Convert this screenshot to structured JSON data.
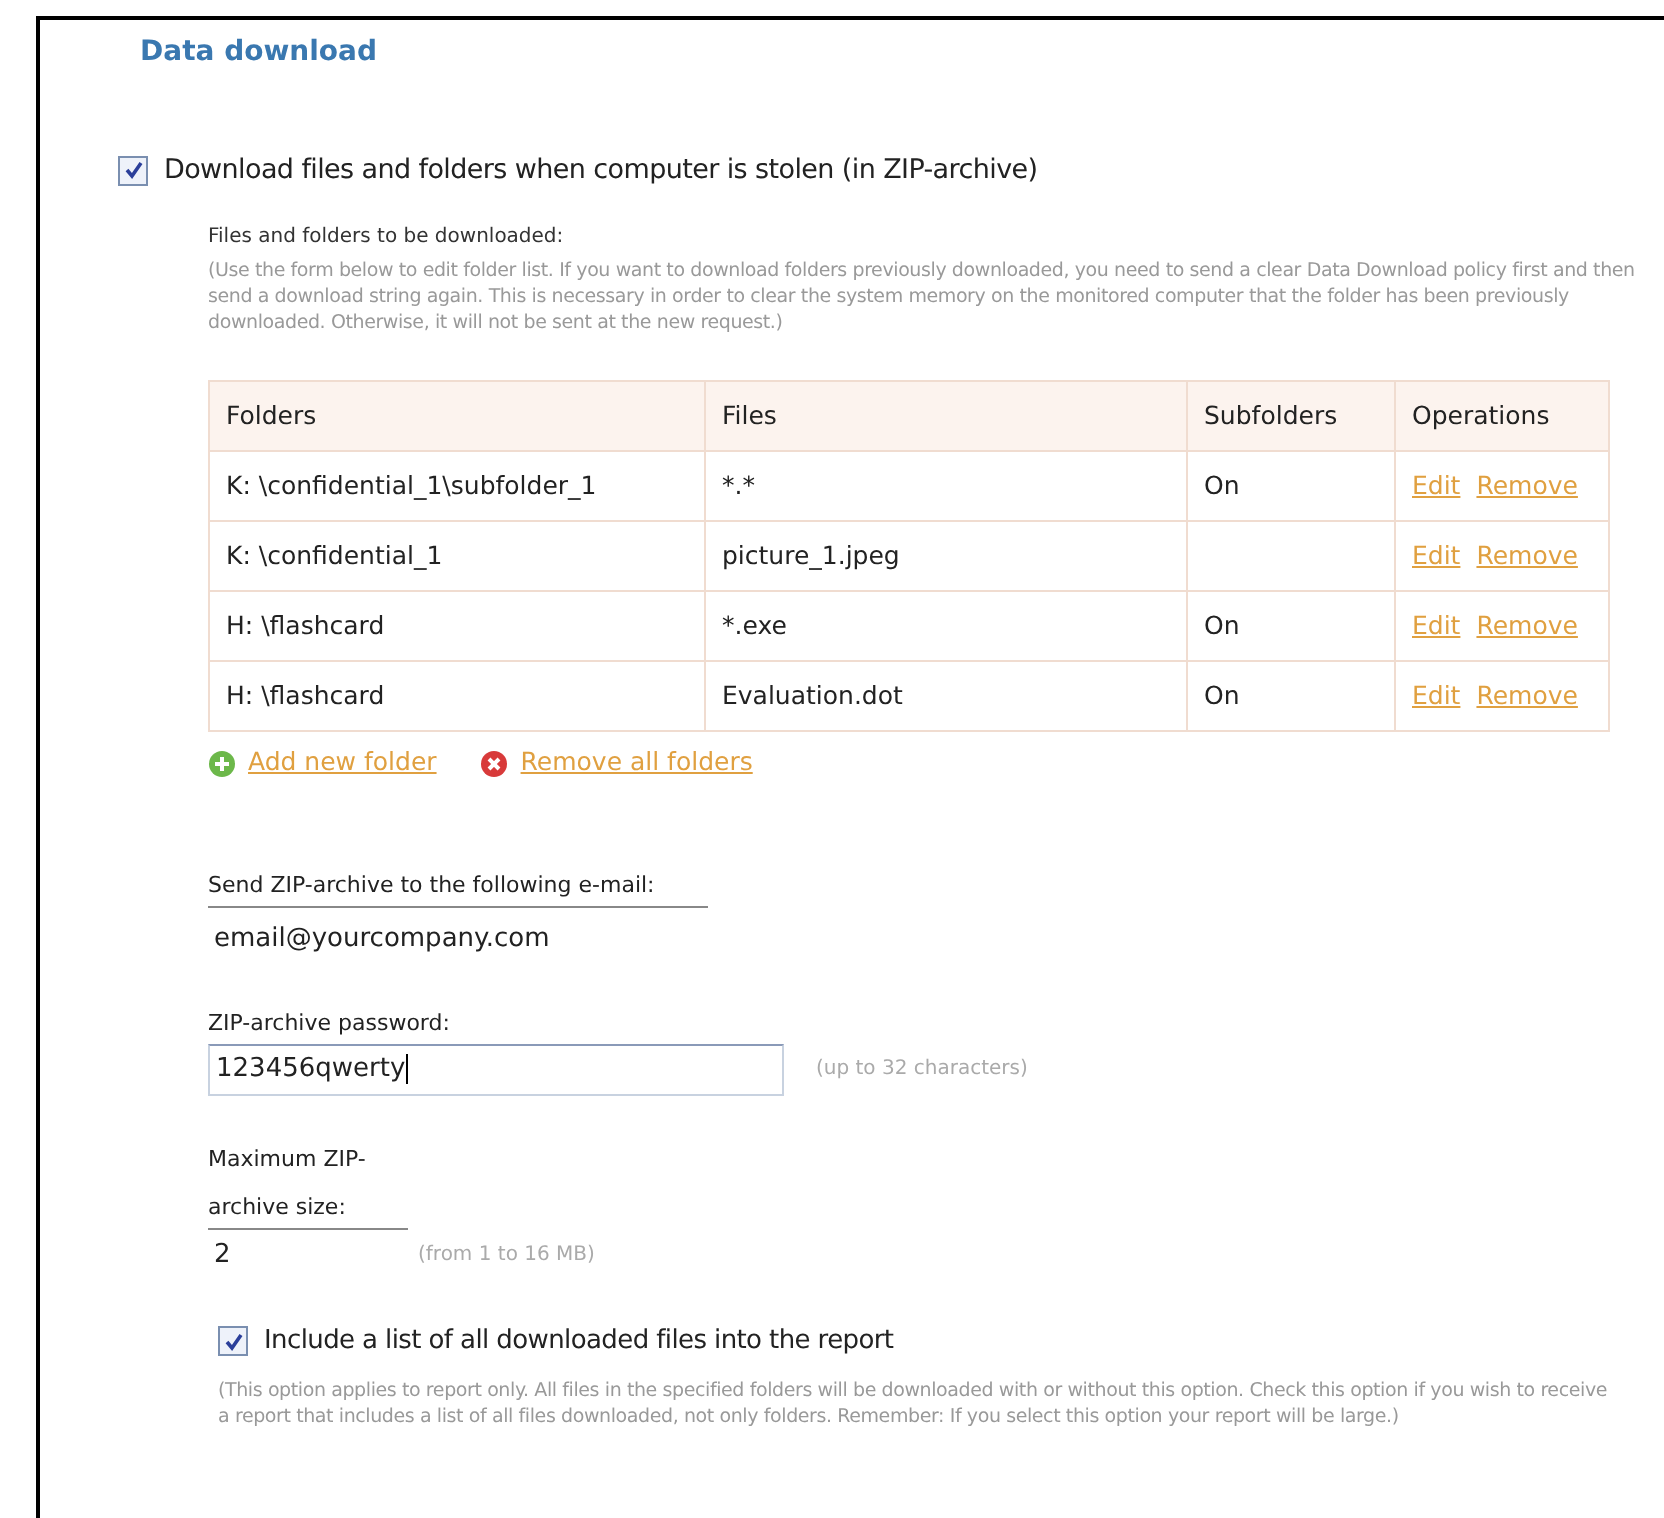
{
  "section_title": "Data download",
  "download_option": {
    "label": "Download files and folders when computer is stolen (in ZIP-archive)",
    "checked": true
  },
  "folders_heading": "Files and folders to be downloaded:",
  "folders_note": "(Use the form below to edit folder list. If you want to download folders previously downloaded, you need to send a clear Data Download policy first and then send a download string again. This is necessary in order to clear the system memory on the monitored computer that the folder has been previously downloaded. Otherwise, it will not be sent at the new request.)",
  "table": {
    "columns": [
      "Folders",
      "Files",
      "Subfolders",
      "Operations"
    ],
    "rows": [
      {
        "folder": "K: \\confidential_1\\subfolder_1",
        "files": "*.*",
        "subfolders": "On",
        "edit": "Edit",
        "remove": "Remove"
      },
      {
        "folder": "K: \\confidential_1",
        "files": "picture_1.jpeg",
        "subfolders": "",
        "edit": "Edit",
        "remove": "Remove"
      },
      {
        "folder": "H: \\flashcard",
        "files": "*.exe",
        "subfolders": "On",
        "edit": "Edit",
        "remove": "Remove"
      },
      {
        "folder": "H: \\flashcard",
        "files": "Evaluation.dot",
        "subfolders": "On",
        "edit": "Edit",
        "remove": "Remove"
      }
    ]
  },
  "actions": [
    {
      "kind": "add",
      "label": "Add new folder"
    },
    {
      "kind": "remove",
      "label": "Remove all folders"
    }
  ],
  "email": {
    "label": "Send ZIP-archive to the following e-mail:",
    "value": "email@yourcompany.com"
  },
  "password": {
    "label": "ZIP-archive password:",
    "value": "123456qwerty",
    "hint": "(up to 32 characters)"
  },
  "max_size": {
    "label": "Maximum ZIP-archive size:",
    "value": "2",
    "hint": "(from 1 to 16 MB)"
  },
  "report_option": {
    "label": "Include a list of all downloaded files into the report",
    "checked": true,
    "note": "(This option applies to report only. All files in the specified folders will be downloaded with or without this option. Check this option if you wish to receive a report that includes a list of all files downloaded, not only folders. Remember: If you select this option your report will be large.)"
  }
}
